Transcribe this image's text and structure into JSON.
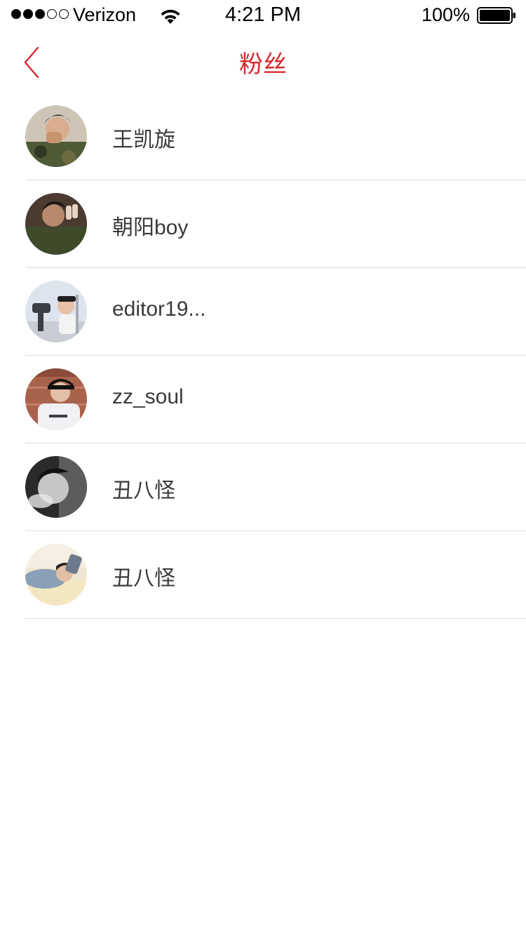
{
  "status_bar": {
    "carrier": "Verizon",
    "time": "4:21 PM",
    "battery": "100%"
  },
  "nav": {
    "title": "粉丝",
    "back_icon": "chevron-left-icon",
    "accent_color": "#d7282d"
  },
  "followers": [
    {
      "name": "王凯旋"
    },
    {
      "name": "朝阳boy"
    },
    {
      "name": "editor19..."
    },
    {
      "name": "zz_soul"
    },
    {
      "name": "丑八怪"
    },
    {
      "name": "丑八怪"
    }
  ]
}
